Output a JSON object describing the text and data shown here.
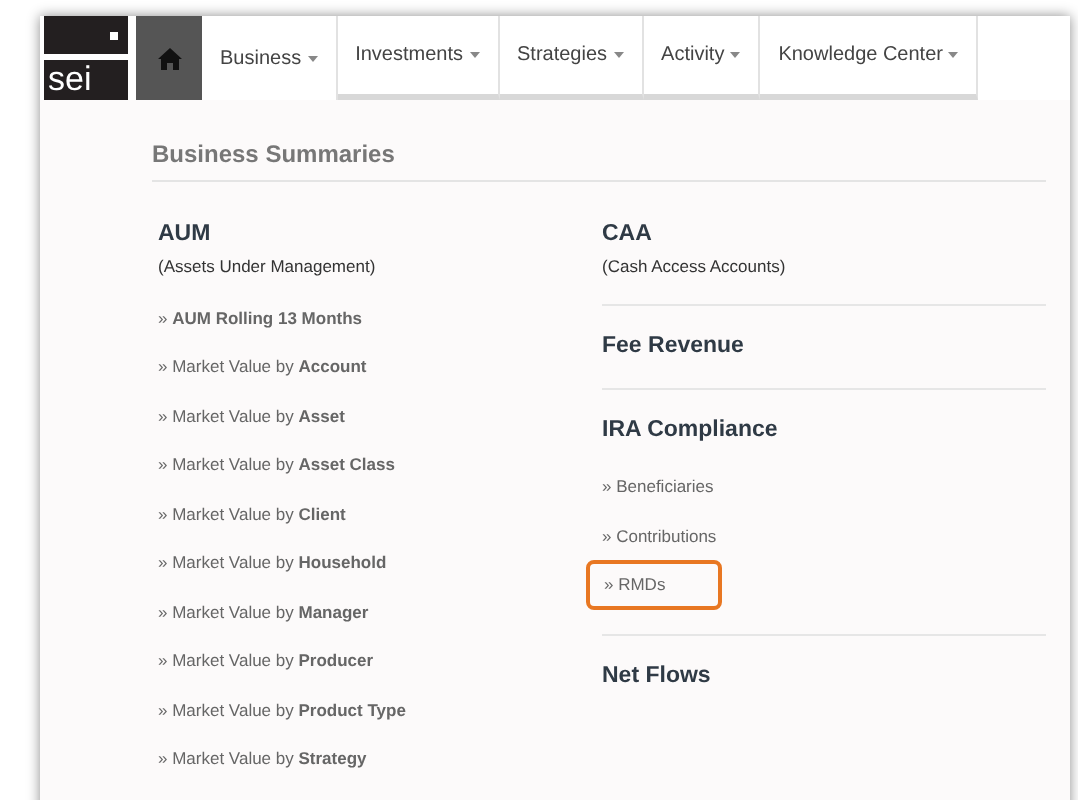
{
  "logo": {
    "text": "sei"
  },
  "nav": [
    {
      "kind": "home",
      "selected": false
    },
    {
      "kind": "menu",
      "label": "Business",
      "selected": true
    },
    {
      "kind": "menu",
      "label": "Investments",
      "selected": false
    },
    {
      "kind": "menu",
      "label": "Strategies",
      "selected": false
    },
    {
      "kind": "menu",
      "label": "Activity",
      "selected": false
    },
    {
      "kind": "menu",
      "label": "Knowledge Center",
      "selected": false
    }
  ],
  "page_title": "Business Summaries",
  "left_column": [
    {
      "title": "AUM",
      "subtitle": "(Assets Under Management)",
      "links": [
        {
          "text": "» **AUM Rolling 13 Months**",
          "highlighted": false
        },
        {
          "text": "» Market Value by **Account**",
          "highlighted": false
        },
        {
          "text": "» Market Value by **Asset**",
          "highlighted": false
        },
        {
          "text": "» Market Value by **Asset Class**",
          "highlighted": false
        },
        {
          "text": "» Market Value by **Client**",
          "highlighted": false
        },
        {
          "text": "» Market Value by **Household**",
          "highlighted": false
        },
        {
          "text": "» Market Value by **Manager**",
          "highlighted": false
        },
        {
          "text": "» Market Value by **Producer**",
          "highlighted": false
        },
        {
          "text": "» Market Value by **Product Type**",
          "highlighted": false
        },
        {
          "text": "» Market Value by **Strategy**",
          "highlighted": false
        }
      ]
    }
  ],
  "right_column": [
    {
      "title": "CAA",
      "subtitle": "(Cash Access Accounts)"
    },
    {
      "title": "Fee Revenue"
    },
    {
      "title": "IRA Compliance",
      "links": [
        {
          "text": "» Beneficiaries",
          "highlighted": false
        },
        {
          "text": "» Contributions",
          "highlighted": false
        },
        {
          "text": "» RMDs",
          "highlighted": true
        }
      ]
    },
    {
      "title": "Net Flows"
    }
  ]
}
